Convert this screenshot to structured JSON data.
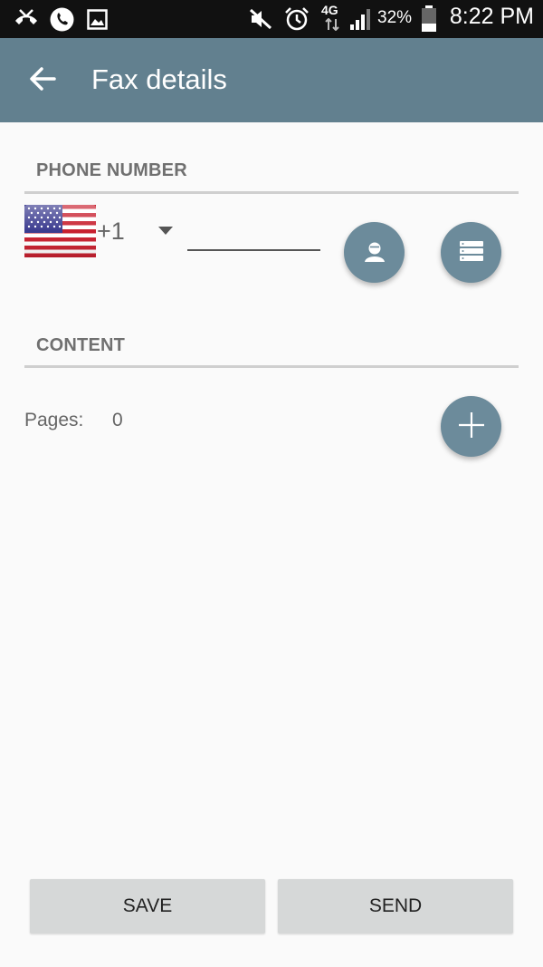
{
  "status_bar": {
    "time": "8:22 PM",
    "battery_percent": "32%",
    "network": "4G",
    "icons": [
      "missed-call-icon",
      "phone-icon",
      "image-icon",
      "mute-icon",
      "alarm-icon",
      "signal-icon",
      "battery-icon"
    ]
  },
  "app_bar": {
    "title": "Fax details",
    "back_icon": "arrow-back-icon",
    "color": "#62808f"
  },
  "phone_section": {
    "header": "PHONE NUMBER",
    "country_flag": "us-flag",
    "country_code": "+1",
    "phone_value": "",
    "contact_button_icon": "contact-icon",
    "list_button_icon": "list-icon"
  },
  "content_section": {
    "header": "CONTENT",
    "pages_label": "Pages:",
    "pages_count": "0",
    "add_button_icon": "plus-icon"
  },
  "actions": {
    "save_label": "SAVE",
    "send_label": "SEND"
  },
  "colors": {
    "accent": "#6c8b9b",
    "button_bg": "#d6d8d8",
    "status_bar": "#111111"
  }
}
